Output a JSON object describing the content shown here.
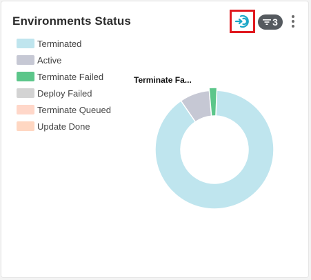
{
  "card": {
    "title": "Environments Status",
    "filter_count": "3"
  },
  "icons": {
    "refresh": "refresh-icon",
    "filter": "filter-icon",
    "menu": "more-vertical-icon"
  },
  "colors": {
    "accent": "#1aa6c7",
    "highlight_border": "#e0191f",
    "pill": "#555a5f"
  },
  "chart_data": {
    "type": "pie",
    "donut": true,
    "legend_position": "top-left",
    "hover_label": "Terminate Fa...",
    "series": [
      {
        "name": "Terminated",
        "value": 88,
        "color": "#bfe5ee"
      },
      {
        "name": "Active",
        "value": 8,
        "color": "#c6c8d4"
      },
      {
        "name": "Terminate Failed",
        "value": 2,
        "color": "#5cc68a"
      },
      {
        "name": "Deploy Failed",
        "value": 0,
        "color": "#d3d3d3"
      },
      {
        "name": "Terminate Queued",
        "value": 0,
        "color": "#ffd7c9"
      },
      {
        "name": "Update Done",
        "value": 0,
        "color": "#ffd7c2"
      }
    ]
  }
}
